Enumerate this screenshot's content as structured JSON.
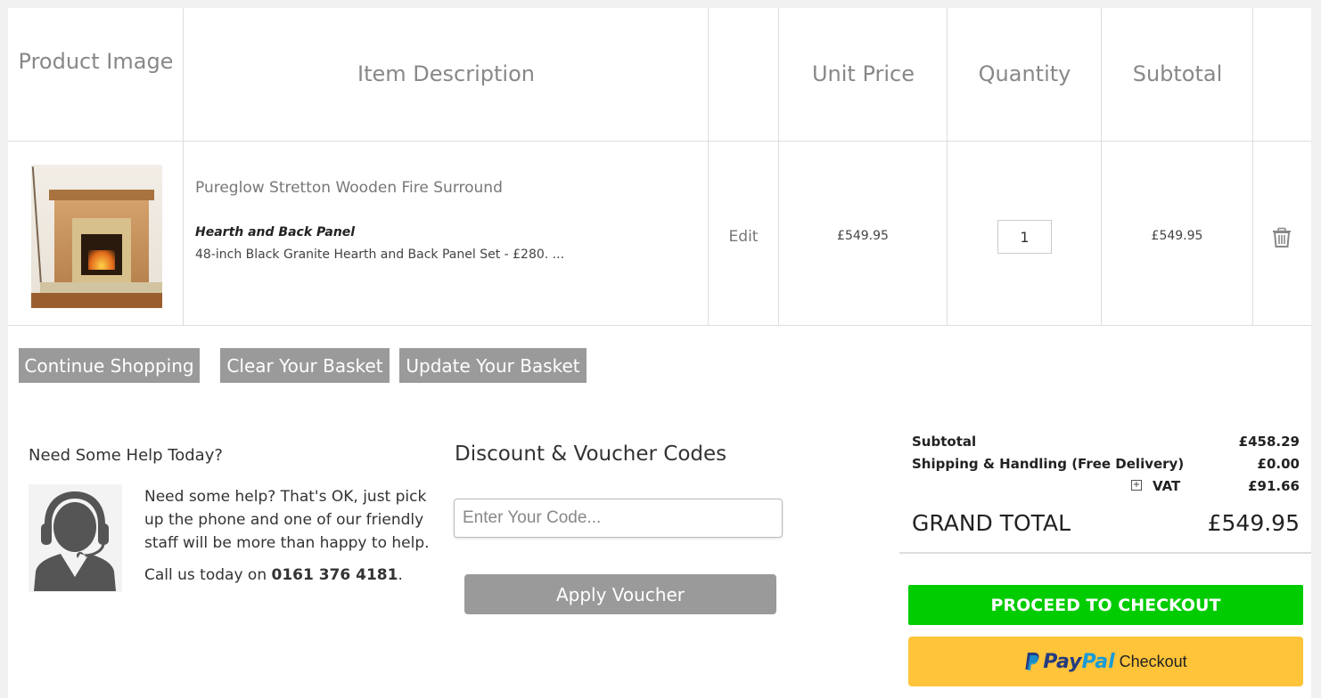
{
  "table": {
    "headers": {
      "product_image": "Product Image",
      "item_description": "Item Description",
      "unit_price": "Unit Price",
      "quantity": "Quantity",
      "subtotal": "Subtotal"
    },
    "item": {
      "name": "Pureglow Stretton Wooden Fire Surround",
      "option_title": "Hearth and Back Panel",
      "option_value": "48-inch Black Granite Hearth and Back Panel Set - £280. ...",
      "edit_label": "Edit",
      "unit_price": "£549.95",
      "quantity": "1",
      "subtotal": "£549.95",
      "remove_icon": "trash-icon"
    }
  },
  "actions": {
    "continue_label": "Continue Shopping",
    "clear_label": "Clear Your Basket",
    "update_label": "Update Your Basket"
  },
  "help": {
    "title": "Need Some Help Today?",
    "text": "Need some help? That's OK, just pick up the phone and one of our friendly staff will be more than happy to help.",
    "call_prefix": "Call us today on ",
    "phone": "0161 376 4181",
    "call_suffix": ".",
    "icon": "support-agent-icon"
  },
  "discount": {
    "title": "Discount & Voucher Codes",
    "placeholder": "Enter Your Code...",
    "apply_label": "Apply Voucher"
  },
  "totals": {
    "subtotal_label": "Subtotal",
    "subtotal_value": "£458.29",
    "shipping_label": "Shipping & Handling (Free Delivery)",
    "shipping_value": "£0.00",
    "vat_toggle": "+",
    "vat_label": "VAT",
    "vat_value": "£91.66",
    "grand_label": "GRAND TOTAL",
    "grand_value": "£549.95"
  },
  "checkout": {
    "proceed_label": "PROCEED TO CHECKOUT",
    "paypal_pay": "Pay",
    "paypal_pal": "Pal",
    "paypal_checkout": "Checkout",
    "proceed_color": "#00cc00",
    "paypal_color": "#ffc439"
  }
}
